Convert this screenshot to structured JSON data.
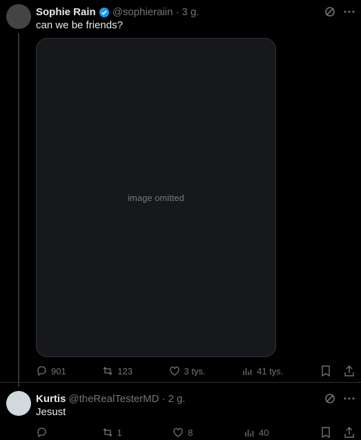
{
  "post": {
    "author_name": "Sophie Rain",
    "handle": "@sophieraiin",
    "time": "3 g.",
    "text": "can we be friends?",
    "replies": "901",
    "reposts": "123",
    "likes": "3 tys.",
    "views": "41 tys."
  },
  "reply": {
    "author_name": "Kurtis",
    "handle": "@theRealTesterMD",
    "time": "2 g.",
    "text": "Jesust",
    "replies": "",
    "reposts": "1",
    "likes": "8",
    "views": "40"
  },
  "colors": {
    "verified": "#1d9bf0",
    "muted": "#71767b"
  }
}
